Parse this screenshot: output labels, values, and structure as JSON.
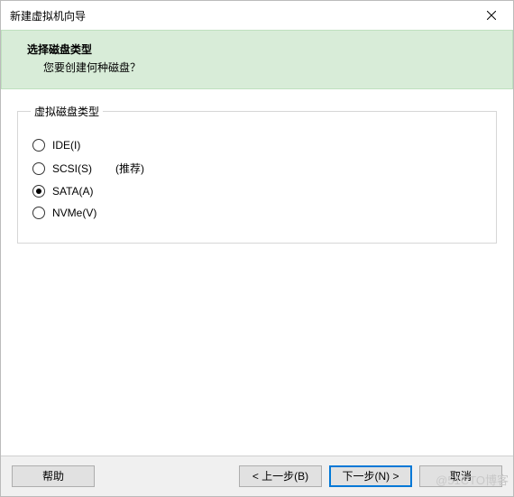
{
  "window": {
    "title": "新建虚拟机向导",
    "close_icon": "close"
  },
  "header": {
    "title": "选择磁盘类型",
    "subtitle": "您要创建何种磁盘？"
  },
  "group": {
    "legend": "虚拟磁盘类型",
    "options": [
      {
        "label": "IDE(I)",
        "checked": false,
        "hint": ""
      },
      {
        "label": "SCSI(S)",
        "checked": false,
        "hint": "(推荐)"
      },
      {
        "label": "SATA(A)",
        "checked": true,
        "hint": ""
      },
      {
        "label": "NVMe(V)",
        "checked": false,
        "hint": ""
      }
    ]
  },
  "buttons": {
    "help": "帮助",
    "back": "< 上一步(B)",
    "next": "下一步(N) >",
    "cancel": "取消"
  },
  "watermark": "@51CTO博客"
}
